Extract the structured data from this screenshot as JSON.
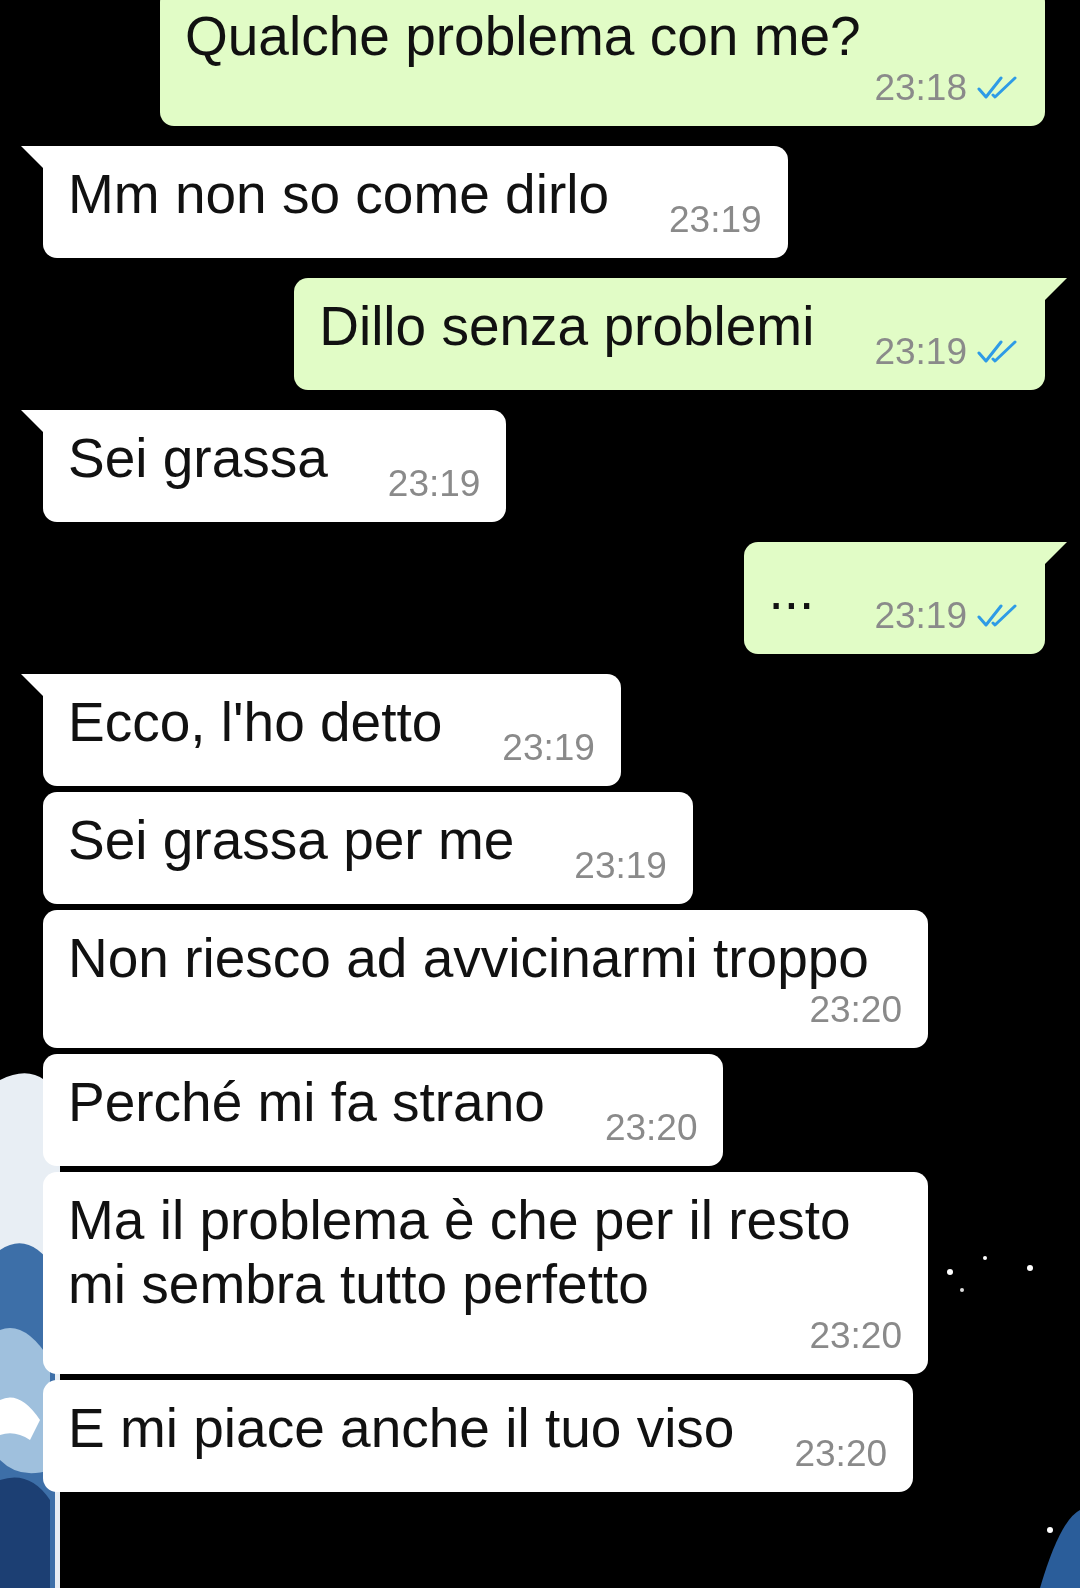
{
  "messages": [
    {
      "kind": "out",
      "text": "Qualche problema con me?",
      "time": "23:18",
      "read": true,
      "tail": false
    },
    {
      "kind": "in",
      "text": "Mm non so come dirlo",
      "time": "23:19",
      "tail": true
    },
    {
      "kind": "out",
      "text": "Dillo senza problemi",
      "time": "23:19",
      "read": true,
      "tail": true
    },
    {
      "kind": "in",
      "text": "Sei grassa",
      "time": "23:19",
      "tail": true
    },
    {
      "kind": "out",
      "text": "...",
      "time": "23:19",
      "read": true,
      "tail": true
    },
    {
      "kind": "in",
      "text": "Ecco, l'ho detto",
      "time": "23:19",
      "tail": true
    },
    {
      "kind": "in",
      "text": "Sei grassa per me",
      "time": "23:19",
      "tail": false
    },
    {
      "kind": "in",
      "text": "Non riesco ad avvicinarmi troppo",
      "time": "23:20",
      "tail": false
    },
    {
      "kind": "in",
      "text": "Perché mi fa strano",
      "time": "23:20",
      "tail": false
    },
    {
      "kind": "in",
      "text": "Ma il problema è che per il resto mi sembra tutto perfetto",
      "time": "23:20",
      "tail": false
    },
    {
      "kind": "in",
      "text": "E mi piace anche il tuo viso",
      "time": "23:20",
      "tail": false
    }
  ]
}
